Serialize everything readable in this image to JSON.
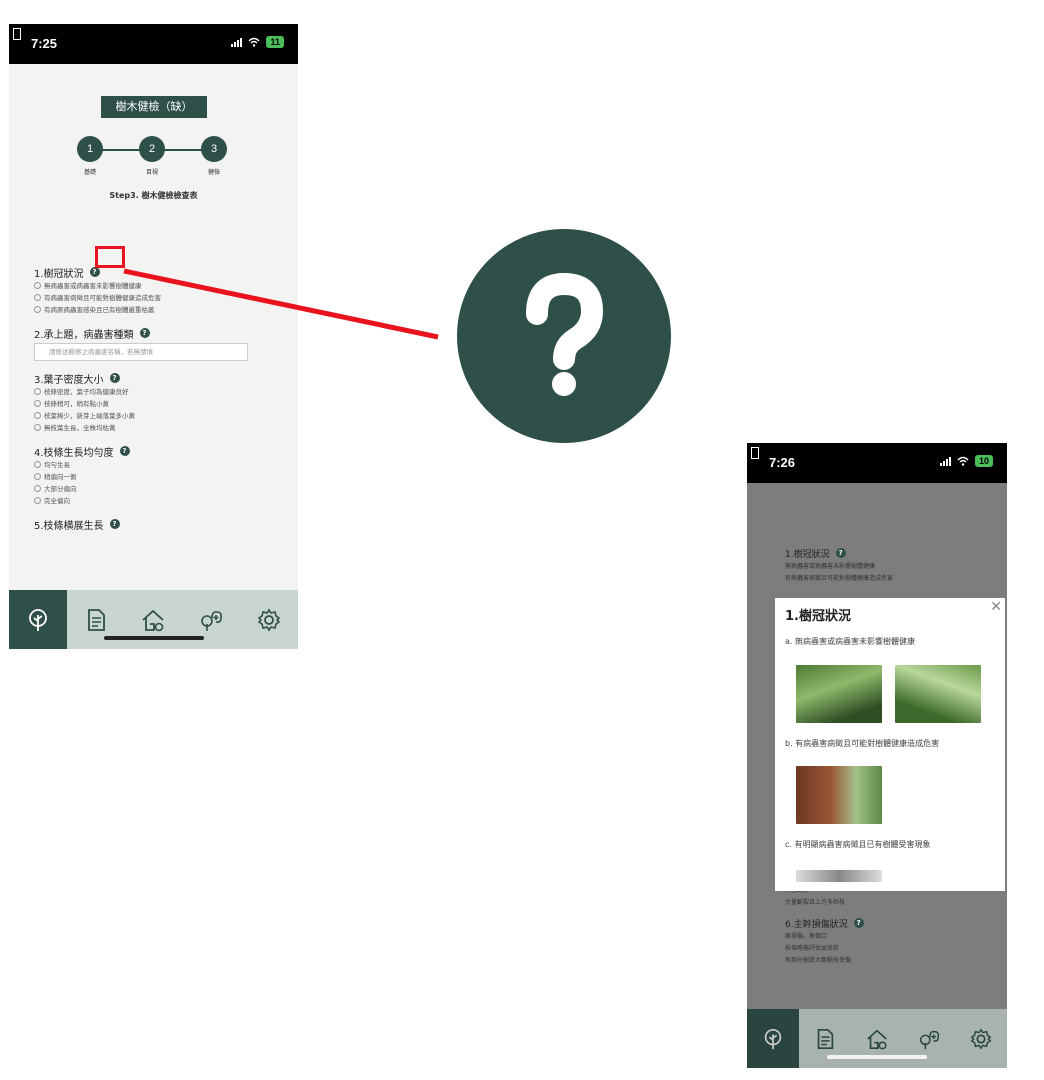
{
  "left": {
    "status": {
      "time": "7:25",
      "battery": "11"
    },
    "badge": "樹木健檢（缺）",
    "steps": [
      {
        "num": "1",
        "label": "基礎"
      },
      {
        "num": "2",
        "label": "目視"
      },
      {
        "num": "3",
        "label": "健檢"
      }
    ],
    "subtitle": "Step3. 樹木健檢檢查表",
    "help": "?",
    "questions": [
      {
        "title": "1.樹冠狀況",
        "options": [
          "無病蟲害或病蟲害未影響樹體健康",
          "有病蟲害病徵且可能對樹體健康造成危害",
          "有病原病蟲害感染且已有樹體嚴重枯萎"
        ]
      },
      {
        "title": "2.承上題，病蟲害種類",
        "placeholder": "請敘述觀察之病蟲害名稱，若無請填"
      },
      {
        "title": "3.葉子密度大小",
        "options": [
          "枝條密度，葉子均為健康良好",
          "枝條稍可，稍有點小黃",
          "枝葉稀少，新芽上端落葉多小黃",
          "無枝葉生長，全株均枯黃"
        ]
      },
      {
        "title": "4.枝條生長均勻度",
        "options": [
          "均勻生長",
          "稍偏向一側",
          "大部分偏向",
          "完全偏向"
        ]
      },
      {
        "title": "5.枝條横展生長",
        "options": []
      }
    ]
  },
  "right": {
    "status": {
      "time": "7:26",
      "battery": "10"
    },
    "bg_top": {
      "title": "1.樹冠狀況",
      "lines": [
        "無病蟲害或病蟲害未影響樹體健康",
        "有病蟲害病徵且可能對樹體健康造成危害"
      ]
    },
    "modal": {
      "title": "1.樹冠狀況",
      "close": "✕",
      "items": [
        "a. 無病蟲害或病蟲害未影響樹體健康",
        "b. 有病蟲害病徵且可能對樹體健康造成危害",
        "c. 有明顯病蟲害病徵且已有樹體受害現象"
      ]
    },
    "bg_bottom": {
      "lines_a": [
        "大量斷裂",
        "大量斷裂且上方多枯枝"
      ],
      "title": "6.主幹損傷狀況",
      "lines_b": [
        "無損傷，無傷口",
        "枝條略傷評估並修剪",
        "有部分樹皮大面積有受傷"
      ]
    }
  },
  "icons": [
    "tree-icon",
    "document-icon",
    "house-icon",
    "tree-add-icon",
    "gear-icon"
  ],
  "colors": {
    "primary": "#2f4f49",
    "nav_bg": "#c9d5cf",
    "highlight": "#e8131f",
    "battery": "#49c05a"
  }
}
